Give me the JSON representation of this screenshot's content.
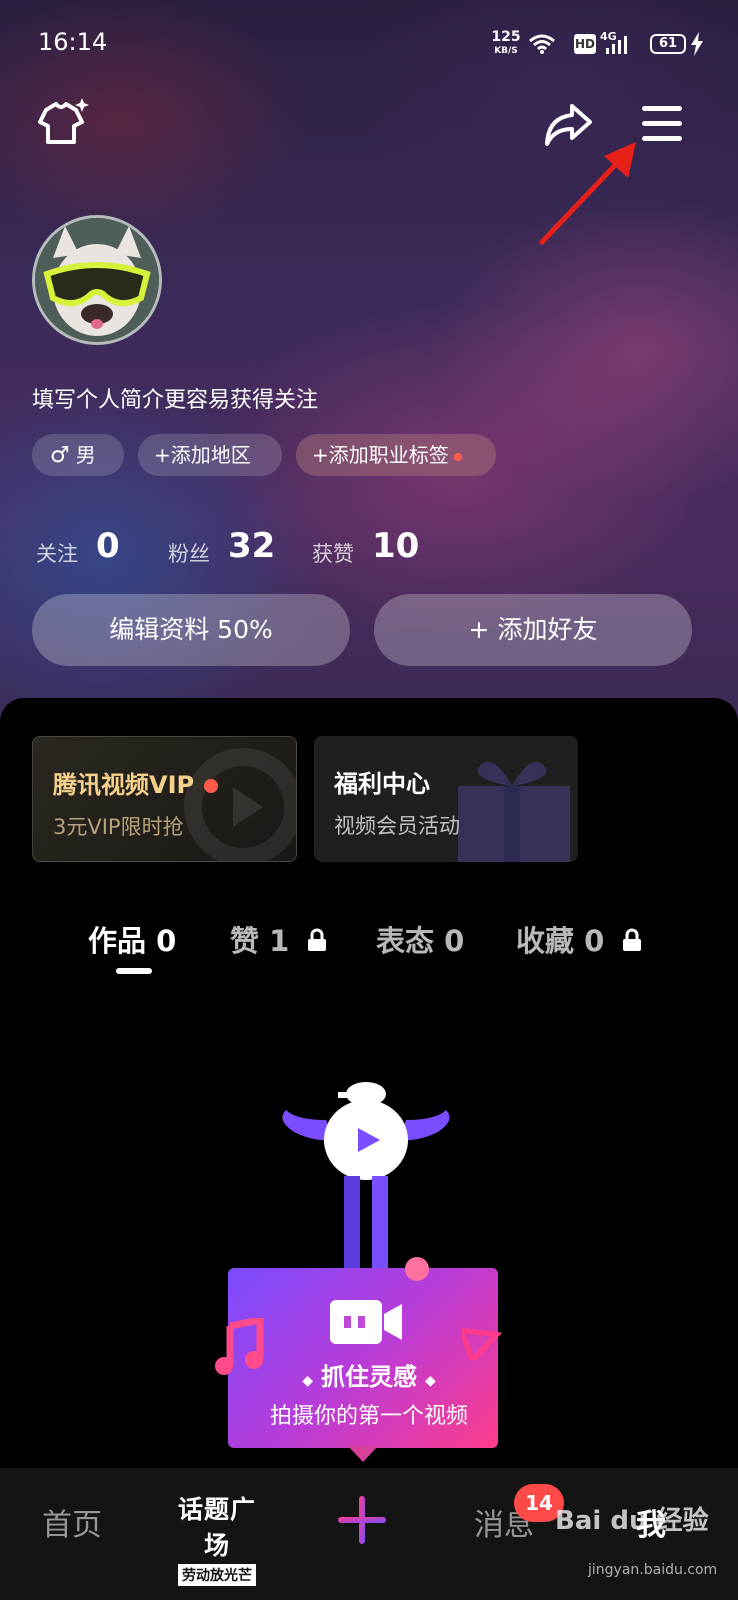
{
  "status_bar": {
    "time": "16:14",
    "net_speed": "125",
    "net_unit": "KB/S",
    "hd": "HD",
    "signal": "4G",
    "battery": "61"
  },
  "profile": {
    "bio_placeholder": "填写个人简介更容易获得关注",
    "tags": {
      "gender": "男",
      "region": "+添加地区",
      "career": "+添加职业标签"
    },
    "stats": {
      "following_label": "关注",
      "following_value": "0",
      "fans_label": "粉丝",
      "fans_value": "32",
      "likes_label": "获赞",
      "likes_value": "10"
    },
    "buttons": {
      "edit": "编辑资料 50%",
      "add_friend": "+ 添加好友"
    }
  },
  "promo_cards": [
    {
      "title": "腾讯视频VIP",
      "subtitle": "3元VIP限时抢"
    },
    {
      "title": "福利中心",
      "subtitle": "视频会员活动"
    }
  ],
  "tabs": [
    {
      "label": "作品 0"
    },
    {
      "label": "赞 1"
    },
    {
      "label": "表态 0"
    },
    {
      "label": "收藏 0"
    }
  ],
  "empty_state": {
    "title": "抓住灵感",
    "subtitle": "拍摄你的第一个视频"
  },
  "bottom_nav": {
    "home": "首页",
    "topic_line1": "话题广场",
    "topic_line2": "劳动放光芒",
    "messages": "消息",
    "messages_badge": "14",
    "me": "我"
  },
  "watermark": {
    "brand": "Bai du 经验",
    "url": "jingyan.baidu.com"
  },
  "colors": {
    "accent_red": "#ff4a4a",
    "vip_gold": "#f5d08a",
    "prompt_gradient_start": "#7b4cff",
    "prompt_gradient_end": "#ff3c8c"
  }
}
